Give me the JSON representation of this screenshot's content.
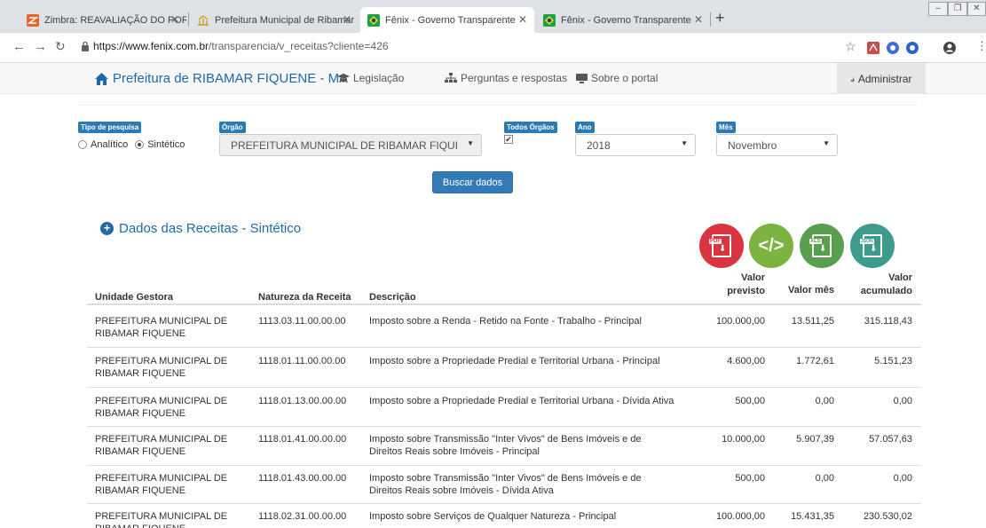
{
  "browser": {
    "tabs": [
      {
        "title": "Zimbra: REAVALIAÇÃO DO PORT",
        "active": false
      },
      {
        "title": "Prefeitura Municipal de Ribamar",
        "active": false
      },
      {
        "title": "Fênix - Governo Transparente",
        "active": true
      },
      {
        "title": "Fênix - Governo Transparente",
        "active": false
      }
    ],
    "url_host": "https://www.fenix.com.br",
    "url_path": "/transparencia/v_receitas?cliente=426"
  },
  "navbar": {
    "brand": "Prefeitura de RIBAMAR FIQUENE - MA",
    "links": [
      "Legislação",
      "Perguntas e respostas",
      "Sobre o portal"
    ],
    "admin": "Administrar"
  },
  "filters": {
    "tipo_label": "Tipo de pesquisa",
    "analitico": "Analítico",
    "sintetico": "Sintético",
    "orgao_label": "Órgão",
    "orgao_value": "PREFEITURA MUNICIPAL DE RIBAMAR FIQUENE",
    "todos_label": "Todos Órgãos",
    "ano_label": "Ano",
    "ano_value": "2018",
    "mes_label": "Mês",
    "mes_value": "Novembro",
    "buscar": "Buscar dados"
  },
  "section": {
    "title": "Dados das Receitas - Sintético",
    "exports": [
      {
        "tag": "PDF",
        "color": "#d9343f"
      },
      {
        "tag": "</>",
        "color": "#7cb342"
      },
      {
        "tag": "XLS",
        "color": "#5a9e4f"
      },
      {
        "tag": "JSON",
        "color": "#3d9a8c"
      }
    ]
  },
  "table": {
    "headers": {
      "unidade": "Unidade Gestora",
      "natureza": "Natureza da Receita",
      "descricao": "Descrição",
      "previsto": "Valor previsto",
      "mes": "Valor mês",
      "acumulado": "Valor acumulado"
    },
    "rows": [
      {
        "unidade": "PREFEITURA MUNICIPAL DE RIBAMAR FIQUENE",
        "natureza": "1113.03.11.00.00.00",
        "descricao": "Imposto sobre a Renda - Retido na Fonte - Trabalho - Principal",
        "previsto": "100.000,00",
        "mes": "13.511,25",
        "acumulado": "315.118,43"
      },
      {
        "unidade": "PREFEITURA MUNICIPAL DE RIBAMAR FIQUENE",
        "natureza": "1118.01.11.00.00.00",
        "descricao": "Imposto sobre a Propriedade Predial e Territorial Urbana - Principal",
        "previsto": "4.600,00",
        "mes": "1.772,61",
        "acumulado": "5.151,23"
      },
      {
        "unidade": "PREFEITURA MUNICIPAL DE RIBAMAR FIQUENE",
        "natureza": "1118.01.13.00.00.00",
        "descricao": "Imposto sobre a Propriedade Predial e Territorial Urbana - Dívida Ativa",
        "previsto": "500,00",
        "mes": "0,00",
        "acumulado": "0,00"
      },
      {
        "unidade": "PREFEITURA MUNICIPAL DE RIBAMAR FIQUENE",
        "natureza": "1118.01.41.00.00.00",
        "descricao": "Imposto sobre Transmissão \"Inter Vivos\" de Bens Imóveis e de Direitos Reais sobre Imóveis - Principal",
        "previsto": "10.000,00",
        "mes": "5.907,39",
        "acumulado": "57.057,63"
      },
      {
        "unidade": "PREFEITURA MUNICIPAL DE RIBAMAR FIQUENE",
        "natureza": "1118.01.43.00.00.00",
        "descricao": "Imposto sobre Transmissão \"Inter Vivos\" de Bens Imóveis e de Direitos Reais sobre Imóveis - Dívida Ativa",
        "previsto": "500,00",
        "mes": "0,00",
        "acumulado": "0,00"
      },
      {
        "unidade": "PREFEITURA MUNICIPAL DE RIBAMAR FIQUENE",
        "natureza": "1118.02.31.00.00.00",
        "descricao": "Imposto sobre Serviços de Qualquer Natureza - Principal",
        "previsto": "100.000,00",
        "mes": "15.431,35",
        "acumulado": "230.530,02"
      }
    ]
  }
}
